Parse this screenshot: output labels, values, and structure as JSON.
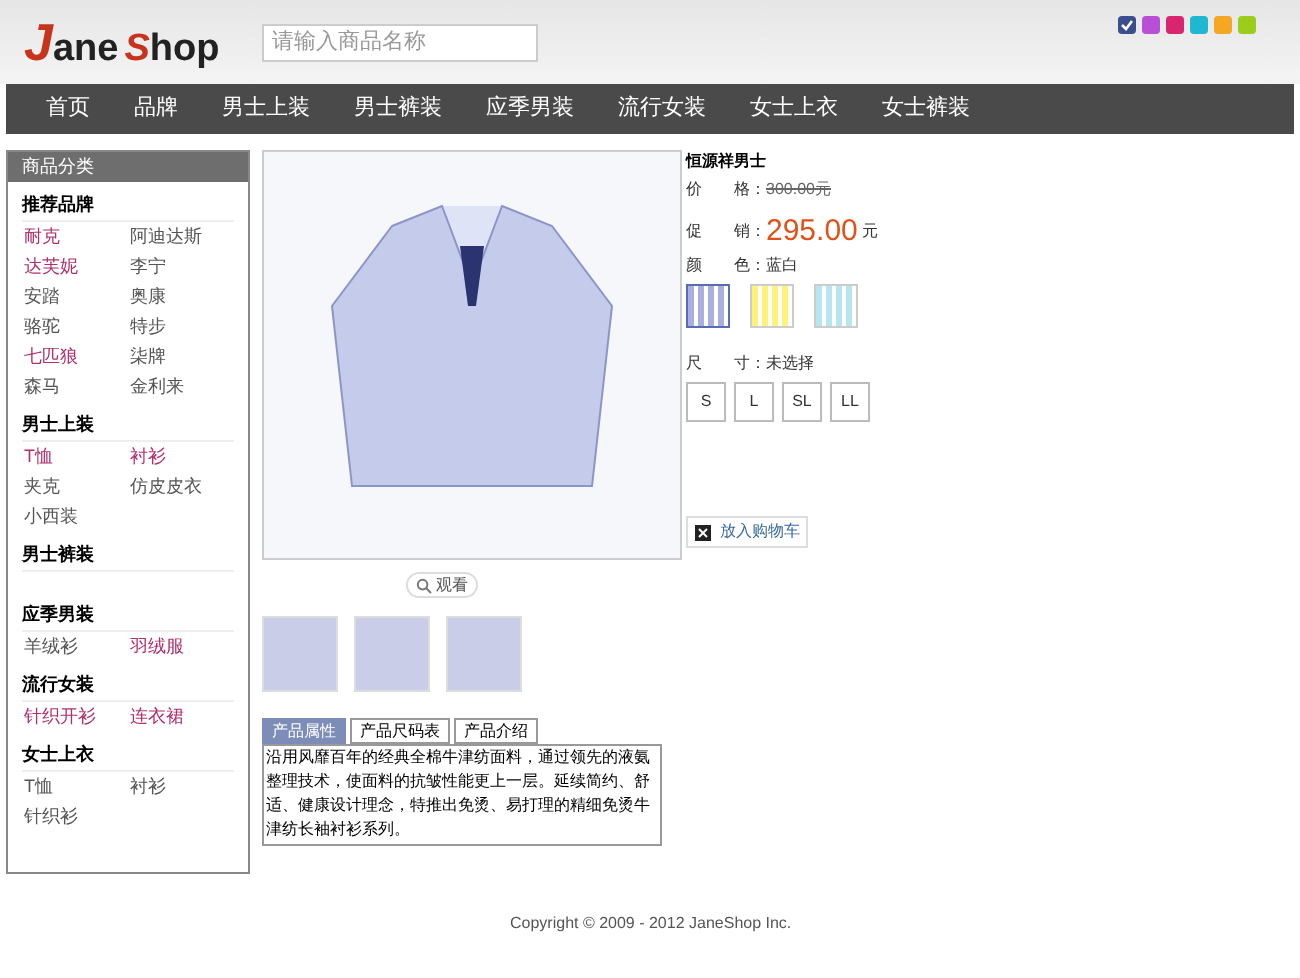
{
  "logo": {
    "initial": "J",
    "part_1": "ane",
    "part_2": "S",
    "part_3": "hop"
  },
  "search": {
    "placeholder": "请输入商品名称"
  },
  "theme_colors": [
    {
      "color": "#3b4f8c",
      "selected": true
    },
    {
      "color": "#b84fd6",
      "selected": false
    },
    {
      "color": "#d9256f",
      "selected": false
    },
    {
      "color": "#1fb8d0",
      "selected": false
    },
    {
      "color": "#f5a623",
      "selected": false
    },
    {
      "color": "#9ccc1c",
      "selected": false
    }
  ],
  "nav": [
    "首页",
    "品牌",
    "男士上装",
    "男士裤装",
    "应季男装",
    "流行女装",
    "女士上衣",
    "女士裤装"
  ],
  "sidebar": {
    "title": "商品分类",
    "groups": [
      {
        "title": "推荐品牌",
        "items": [
          {
            "label": "耐克",
            "highlighted": true
          },
          {
            "label": "阿迪达斯",
            "highlighted": false
          },
          {
            "label": "达芙妮",
            "highlighted": true
          },
          {
            "label": "李宁",
            "highlighted": false
          },
          {
            "label": "安踏",
            "highlighted": false
          },
          {
            "label": "奥康",
            "highlighted": false
          },
          {
            "label": "骆驼",
            "highlighted": false
          },
          {
            "label": "特步",
            "highlighted": false
          },
          {
            "label": "七匹狼",
            "highlighted": true
          },
          {
            "label": "柒牌",
            "highlighted": false
          },
          {
            "label": "森马",
            "highlighted": false
          },
          {
            "label": "金利来",
            "highlighted": false
          }
        ]
      },
      {
        "title": "男士上装",
        "items": [
          {
            "label": "T恤",
            "highlighted": true
          },
          {
            "label": "衬衫",
            "highlighted": true
          },
          {
            "label": "夹克",
            "highlighted": false
          },
          {
            "label": "仿皮皮衣",
            "highlighted": false
          },
          {
            "label": "小西装",
            "highlighted": false
          }
        ]
      },
      {
        "title": "男士裤装"
      },
      {
        "title": "应季男装",
        "items": [
          {
            "label": "羊绒衫",
            "highlighted": false
          },
          {
            "label": "羽绒服",
            "highlighted": true
          }
        ]
      },
      {
        "title": "流行女装",
        "items": [
          {
            "label": "针织开衫",
            "highlighted": true
          },
          {
            "label": "连衣裙",
            "highlighted": true
          }
        ]
      },
      {
        "title": "女士上衣",
        "items": [
          {
            "label": "T恤",
            "highlighted": false
          },
          {
            "label": "衬衫",
            "highlighted": false
          },
          {
            "label": "针织衫",
            "highlighted": false
          }
        ]
      }
    ]
  },
  "product": {
    "name": "恒源祥男士",
    "price_label": "价　　格：",
    "price": "300.00元",
    "promo_label": "促　　销：",
    "promo_price": "295.00",
    "promo_unit": "元",
    "color_label": "颜　　色：",
    "color_value": "蓝白",
    "swatches": [
      {
        "color": "#a9b0e0",
        "selected": true
      },
      {
        "color": "#fff27a",
        "selected": false
      },
      {
        "color": "#b8e6ee",
        "selected": false
      }
    ],
    "size_label": "尺　　寸：",
    "size_value": "未选择",
    "sizes": [
      {
        "label": "S",
        "selected": false
      },
      {
        "label": "L",
        "selected": false
      },
      {
        "label": "SL",
        "selected": false
      },
      {
        "label": "LL",
        "selected": false
      }
    ],
    "zoom_link": "观看",
    "cart_button": "放入购物车"
  },
  "tabs": [
    {
      "label": "产品属性",
      "selected": true
    },
    {
      "label": "产品尺码表",
      "selected": false
    },
    {
      "label": "产品介绍",
      "selected": false
    }
  ],
  "description": "沿用风靡百年的经典全棉牛津纺面料，通过领先的液氨整理技术，使面料的抗皱性能更上一层。延续简约、舒适、健康设计理念，特推出免烫、易打理的精细免烫牛津纺长袖衬衫系列。",
  "footer": "Copyright © 2009 - 2012 JaneShop Inc."
}
